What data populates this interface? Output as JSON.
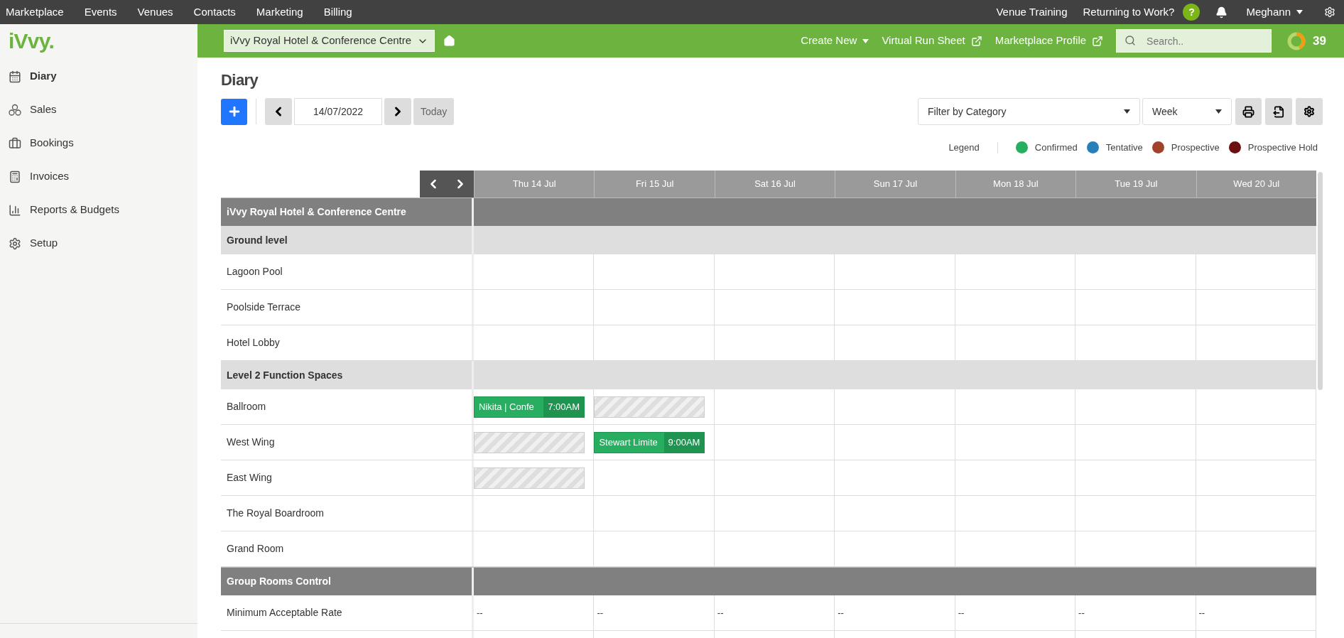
{
  "top_nav": {
    "items": [
      "Marketplace",
      "Events",
      "Venues",
      "Contacts",
      "Marketing",
      "Billing"
    ],
    "links": [
      "Venue Training",
      "Returning to Work?"
    ],
    "help": "?",
    "user": "Meghann"
  },
  "logo": "iVvy.",
  "sidebar": {
    "items": [
      {
        "label": "Diary",
        "selected": true
      },
      {
        "label": "Sales",
        "selected": false
      },
      {
        "label": "Bookings",
        "selected": false
      },
      {
        "label": "Invoices",
        "selected": false
      },
      {
        "label": "Reports & Budgets",
        "selected": false
      },
      {
        "label": "Setup",
        "selected": false
      }
    ]
  },
  "venue_bar": {
    "venue": "iVvy Royal Hotel & Conference Centre",
    "create_new": "Create New",
    "links": [
      "Virtual Run Sheet",
      "Marketplace Profile"
    ],
    "search": {
      "placeholder": "Search.."
    },
    "count": "39"
  },
  "page_title": "Diary",
  "toolbar": {
    "date": "14/07/2022",
    "today": "Today",
    "filter": "Filter by Category",
    "view": "Week"
  },
  "legend": {
    "title": "Legend",
    "items": [
      {
        "label": "Confirmed",
        "color": "#27ae60"
      },
      {
        "label": "Tentative",
        "color": "#2980b9"
      },
      {
        "label": "Prospective",
        "color": "#a0432a"
      },
      {
        "label": "Prospective Hold",
        "color": "#6b0f0f"
      }
    ]
  },
  "days": [
    "Thu 14 Jul",
    "Fri 15 Jul",
    "Sat 16 Jul",
    "Sun 17 Jul",
    "Mon 18 Jul",
    "Tue 19 Jul",
    "Wed 20 Jul"
  ],
  "rows": [
    {
      "kind": "venue",
      "label": "iVvy Royal Hotel & Conference Centre"
    },
    {
      "kind": "group",
      "label": "Ground level"
    },
    {
      "kind": "room",
      "label": "Lagoon Pool",
      "cells": [
        {
          "kind": "empty"
        },
        {
          "kind": "empty"
        },
        {
          "kind": "empty"
        },
        {
          "kind": "empty"
        },
        {
          "kind": "empty"
        },
        {
          "kind": "empty"
        },
        {
          "kind": "empty"
        }
      ]
    },
    {
      "kind": "room",
      "label": "Poolside Terrace",
      "cells": [
        {
          "kind": "empty"
        },
        {
          "kind": "empty"
        },
        {
          "kind": "empty"
        },
        {
          "kind": "empty"
        },
        {
          "kind": "empty"
        },
        {
          "kind": "empty"
        },
        {
          "kind": "empty"
        }
      ]
    },
    {
      "kind": "room",
      "label": "Hotel Lobby",
      "cells": [
        {
          "kind": "empty"
        },
        {
          "kind": "empty"
        },
        {
          "kind": "empty"
        },
        {
          "kind": "empty"
        },
        {
          "kind": "empty"
        },
        {
          "kind": "empty"
        },
        {
          "kind": "empty"
        }
      ]
    },
    {
      "kind": "group",
      "label": "Level 2 Function Spaces"
    },
    {
      "kind": "room",
      "label": "Ballroom",
      "cells": [
        {
          "kind": "booking",
          "label": "Nikita | Confe",
          "time": "7:00AM"
        },
        {
          "kind": "blocked"
        },
        {
          "kind": "empty"
        },
        {
          "kind": "empty"
        },
        {
          "kind": "empty"
        },
        {
          "kind": "empty"
        },
        {
          "kind": "empty"
        }
      ]
    },
    {
      "kind": "room",
      "label": "West Wing",
      "cells": [
        {
          "kind": "blocked"
        },
        {
          "kind": "booking",
          "label": "Stewart Limite",
          "time": "9:00AM"
        },
        {
          "kind": "empty"
        },
        {
          "kind": "empty"
        },
        {
          "kind": "empty"
        },
        {
          "kind": "empty"
        },
        {
          "kind": "empty"
        }
      ]
    },
    {
      "kind": "room",
      "label": "East Wing",
      "cells": [
        {
          "kind": "blocked"
        },
        {
          "kind": "empty"
        },
        {
          "kind": "empty"
        },
        {
          "kind": "empty"
        },
        {
          "kind": "empty"
        },
        {
          "kind": "empty"
        },
        {
          "kind": "empty"
        }
      ]
    },
    {
      "kind": "room",
      "label": "The Royal Boardroom",
      "cells": [
        {
          "kind": "empty"
        },
        {
          "kind": "empty"
        },
        {
          "kind": "empty"
        },
        {
          "kind": "empty"
        },
        {
          "kind": "empty"
        },
        {
          "kind": "empty"
        },
        {
          "kind": "empty"
        }
      ]
    },
    {
      "kind": "room",
      "label": "Grand Room",
      "cells": [
        {
          "kind": "empty"
        },
        {
          "kind": "empty"
        },
        {
          "kind": "empty"
        },
        {
          "kind": "empty"
        },
        {
          "kind": "empty"
        },
        {
          "kind": "empty"
        },
        {
          "kind": "empty"
        }
      ]
    },
    {
      "kind": "venue",
      "label": "Group Rooms Control"
    },
    {
      "kind": "room",
      "label": "Minimum Acceptable Rate",
      "cells": [
        {
          "kind": "text",
          "text": "--"
        },
        {
          "kind": "text",
          "text": "--"
        },
        {
          "kind": "text",
          "text": "--"
        },
        {
          "kind": "text",
          "text": "--"
        },
        {
          "kind": "text",
          "text": "--"
        },
        {
          "kind": "text",
          "text": "--"
        },
        {
          "kind": "text",
          "text": "--"
        }
      ]
    },
    {
      "kind": "room",
      "cells": [
        {
          "kind": "empty"
        },
        {
          "kind": "empty"
        },
        {
          "kind": "empty"
        },
        {
          "kind": "empty"
        },
        {
          "kind": "empty"
        },
        {
          "kind": "empty"
        },
        {
          "kind": "empty"
        }
      ]
    }
  ]
}
